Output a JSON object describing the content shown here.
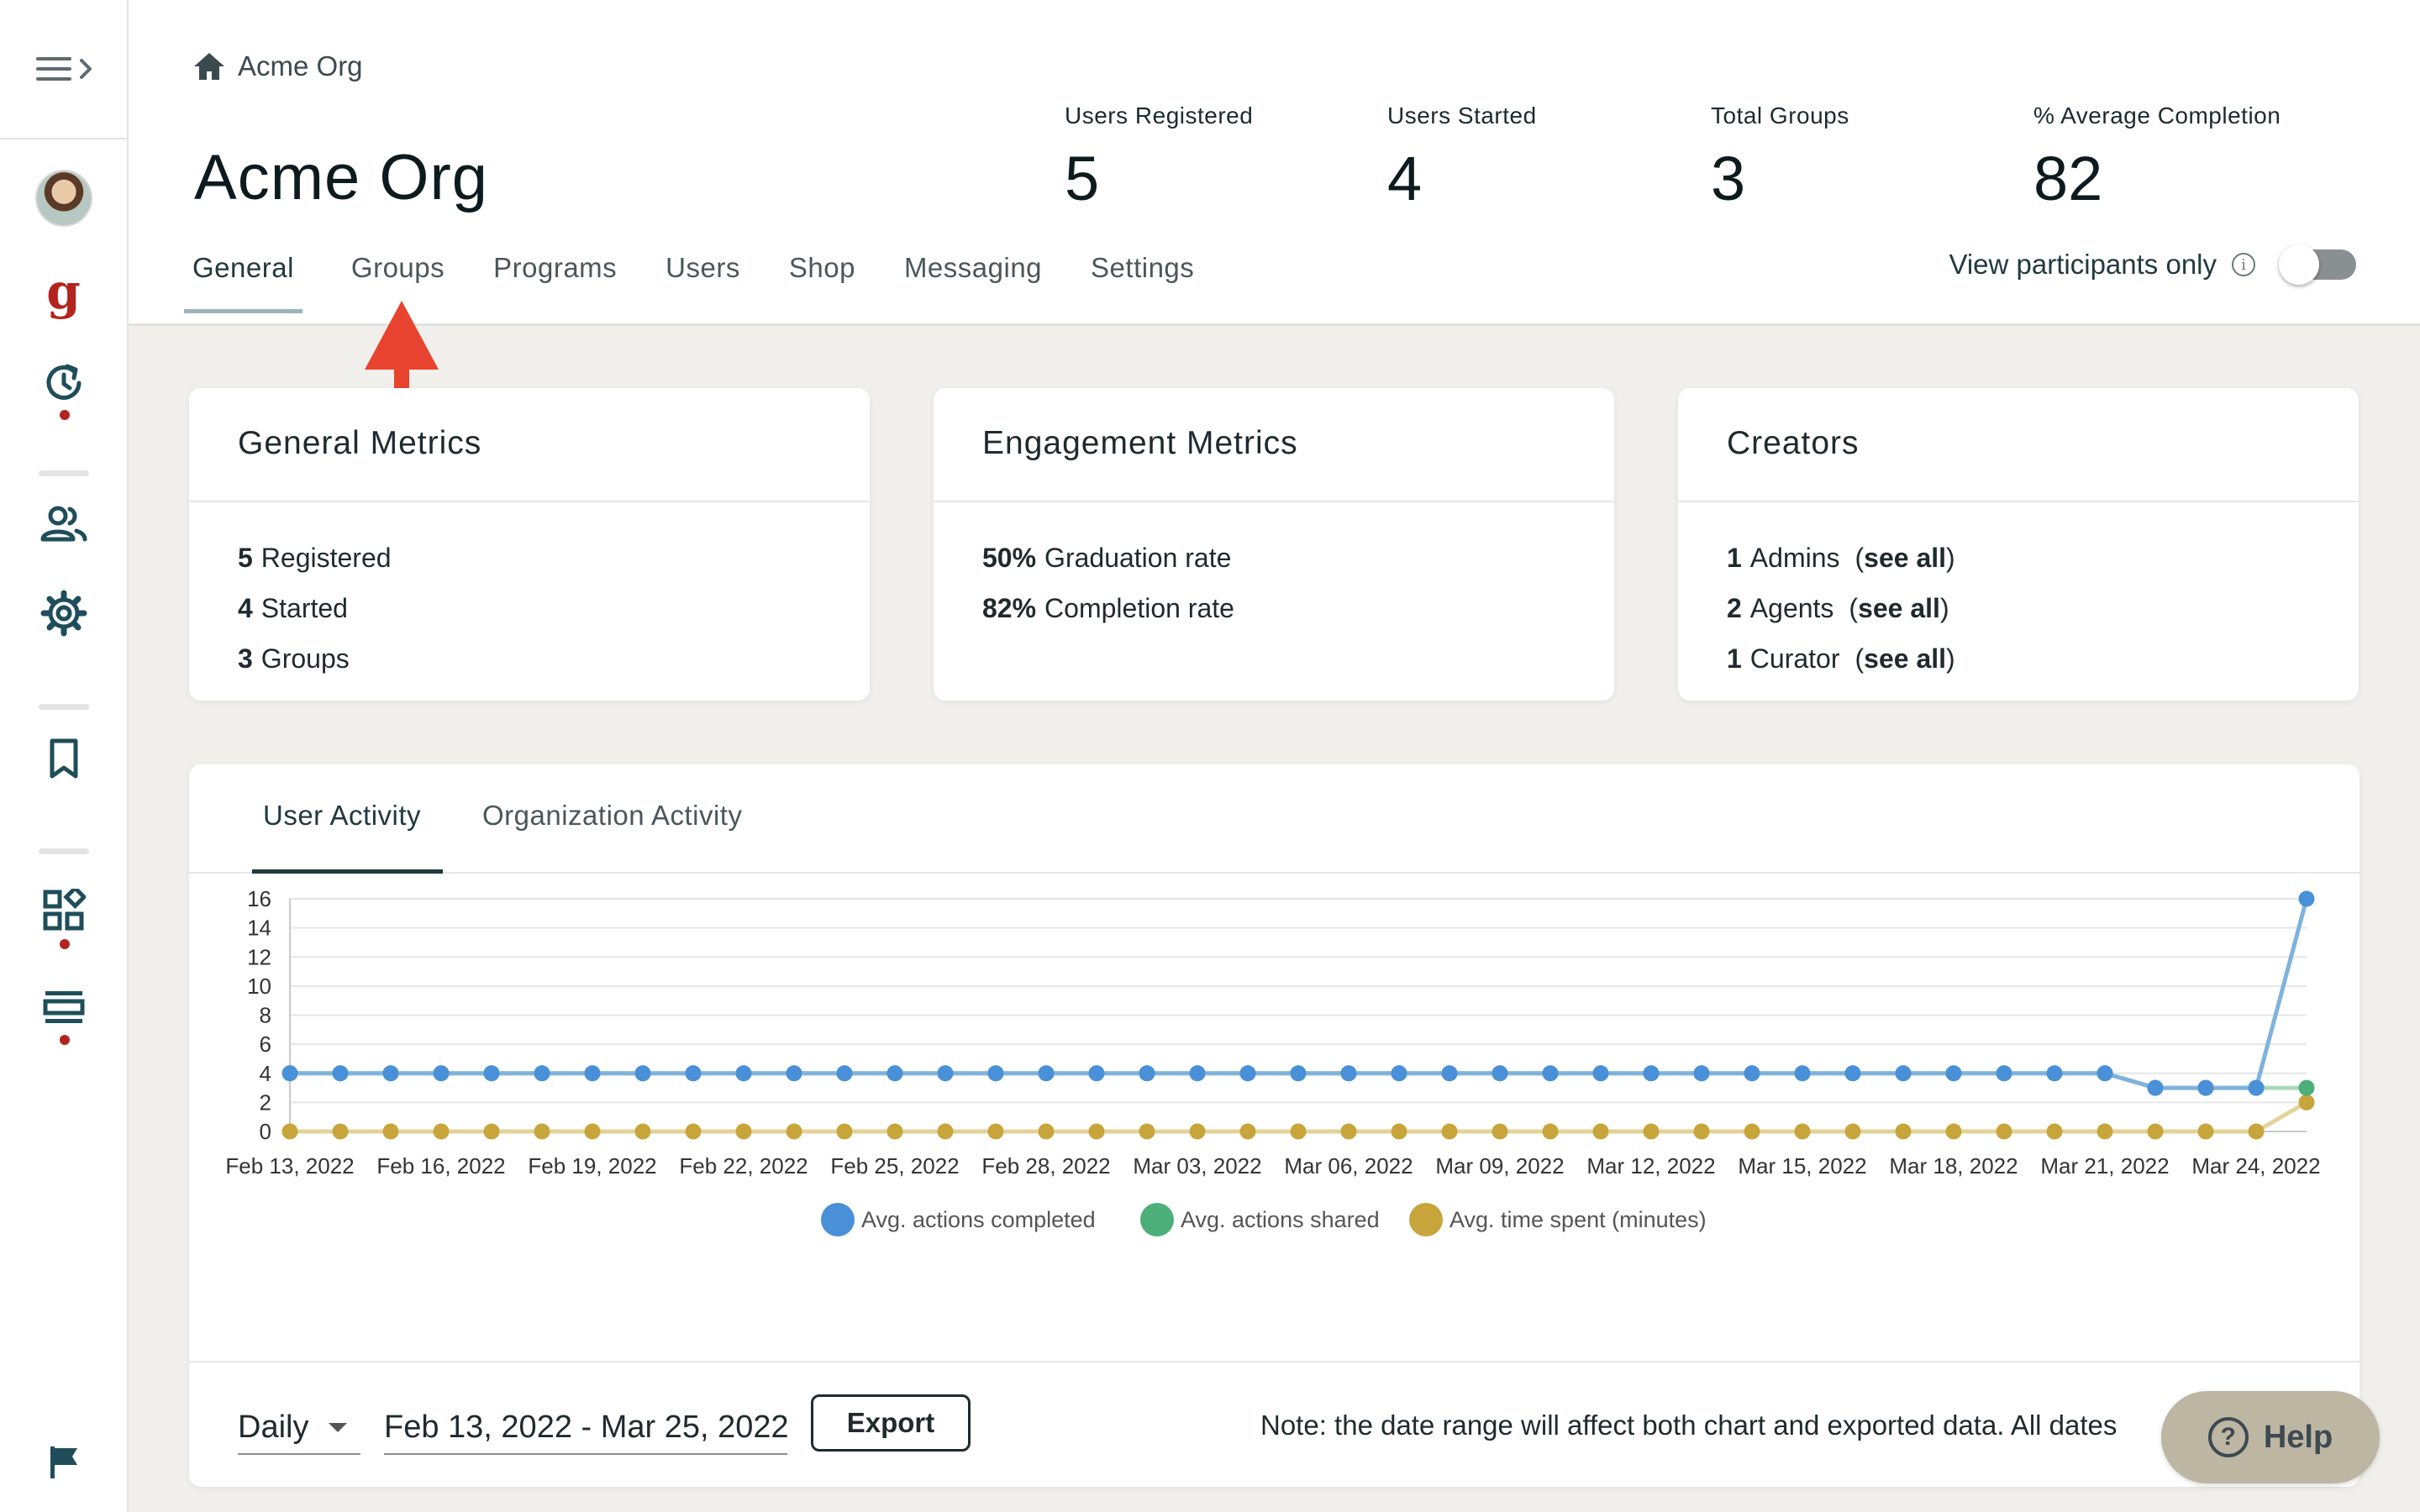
{
  "sidebar": {
    "icons": [
      "menu-icon",
      "avatar",
      "g-logo",
      "activity-icon",
      "users-icon",
      "gear-icon",
      "bookmark-icon",
      "widgets-icon",
      "list-icon",
      "flag-icon"
    ],
    "logo_letter": "g",
    "accent": "#b3241f",
    "icon_color": "#1f4e5a"
  },
  "header": {
    "breadcrumb": "Acme Org",
    "title": "Acme Org",
    "stats": [
      {
        "label": "Users Registered",
        "value": "5"
      },
      {
        "label": "Users Started",
        "value": "4"
      },
      {
        "label": "Total Groups",
        "value": "3"
      },
      {
        "label": "% Average Completion",
        "value": "82"
      }
    ],
    "tabs": [
      "General",
      "Groups",
      "Programs",
      "Users",
      "Shop",
      "Messaging",
      "Settings"
    ],
    "active_tab": "General",
    "toggle_label": "View participants only",
    "toggle_on": false
  },
  "cards": {
    "general": {
      "title": "General Metrics",
      "rows": [
        {
          "value": "5",
          "label": "Registered"
        },
        {
          "value": "4",
          "label": "Started"
        },
        {
          "value": "3",
          "label": "Groups"
        }
      ]
    },
    "engagement": {
      "title": "Engagement Metrics",
      "rows": [
        {
          "value": "50%",
          "label": "Graduation rate"
        },
        {
          "value": "82%",
          "label": "Completion rate"
        }
      ]
    },
    "creators": {
      "title": "Creators",
      "see_all": "see all",
      "rows": [
        {
          "value": "1",
          "label": "Admins"
        },
        {
          "value": "2",
          "label": "Agents"
        },
        {
          "value": "1",
          "label": "Curator"
        }
      ]
    }
  },
  "activity": {
    "tabs": [
      "User Activity",
      "Organization Activity"
    ],
    "active_tab": "User Activity",
    "interval": "Daily",
    "date_range": "Feb 13, 2022 - Mar 25, 2022",
    "export_label": "Export",
    "note": "Note: the date range will affect both chart and exported data. All dates"
  },
  "chart_data": {
    "type": "line",
    "x": [
      "Feb 13, 2022",
      "Feb 14, 2022",
      "Feb 15, 2022",
      "Feb 16, 2022",
      "Feb 17, 2022",
      "Feb 18, 2022",
      "Feb 19, 2022",
      "Feb 20, 2022",
      "Feb 21, 2022",
      "Feb 22, 2022",
      "Feb 23, 2022",
      "Feb 24, 2022",
      "Feb 25, 2022",
      "Feb 26, 2022",
      "Feb 27, 2022",
      "Feb 28, 2022",
      "Mar 01, 2022",
      "Mar 02, 2022",
      "Mar 03, 2022",
      "Mar 04, 2022",
      "Mar 05, 2022",
      "Mar 06, 2022",
      "Mar 07, 2022",
      "Mar 08, 2022",
      "Mar 09, 2022",
      "Mar 10, 2022",
      "Mar 11, 2022",
      "Mar 12, 2022",
      "Mar 13, 2022",
      "Mar 14, 2022",
      "Mar 15, 2022",
      "Mar 16, 2022",
      "Mar 17, 2022",
      "Mar 18, 2022",
      "Mar 19, 2022",
      "Mar 20, 2022",
      "Mar 21, 2022",
      "Mar 22, 2022",
      "Mar 23, 2022",
      "Mar 24, 2022",
      "Mar 25, 2022"
    ],
    "x_tick_labels": [
      "Feb 13, 2022",
      "Feb 16, 2022",
      "Feb 19, 2022",
      "Feb 22, 2022",
      "Feb 25, 2022",
      "Feb 28, 2022",
      "Mar 03, 2022",
      "Mar 06, 2022",
      "Mar 09, 2022",
      "Mar 12, 2022",
      "Mar 15, 2022",
      "Mar 18, 2022",
      "Mar 21, 2022",
      "Mar 24, 2022"
    ],
    "y_ticks": [
      0,
      2,
      4,
      6,
      8,
      10,
      12,
      14,
      16
    ],
    "ylim": [
      0,
      16
    ],
    "grid": true,
    "legend": "bottom",
    "series": [
      {
        "name": "Avg. actions completed",
        "color": "#4a90d9",
        "line_color": "#7fb3dc",
        "values": [
          4,
          4,
          4,
          4,
          4,
          4,
          4,
          4,
          4,
          4,
          4,
          4,
          4,
          4,
          4,
          4,
          4,
          4,
          4,
          4,
          4,
          4,
          4,
          4,
          4,
          4,
          4,
          4,
          4,
          4,
          4,
          4,
          4,
          4,
          4,
          4,
          4,
          3,
          3,
          3,
          16
        ]
      },
      {
        "name": "Avg. actions shared",
        "color": "#4caf7a",
        "line_color": "#a8d8b9",
        "values": [
          4,
          4,
          4,
          4,
          4,
          4,
          4,
          4,
          4,
          4,
          4,
          4,
          4,
          4,
          4,
          4,
          4,
          4,
          4,
          4,
          4,
          4,
          4,
          4,
          4,
          4,
          4,
          4,
          4,
          4,
          4,
          4,
          4,
          4,
          4,
          4,
          4,
          3,
          3,
          3,
          3
        ]
      },
      {
        "name": "Avg. time spent (minutes)",
        "color": "#c7a53a",
        "line_color": "#e3d39a",
        "values": [
          0,
          0,
          0,
          0,
          0,
          0,
          0,
          0,
          0,
          0,
          0,
          0,
          0,
          0,
          0,
          0,
          0,
          0,
          0,
          0,
          0,
          0,
          0,
          0,
          0,
          0,
          0,
          0,
          0,
          0,
          0,
          0,
          0,
          0,
          0,
          0,
          0,
          0,
          0,
          0,
          2
        ]
      }
    ]
  },
  "help": {
    "label": "Help",
    "icon": "question-icon",
    "color": "#bdb6a3"
  }
}
